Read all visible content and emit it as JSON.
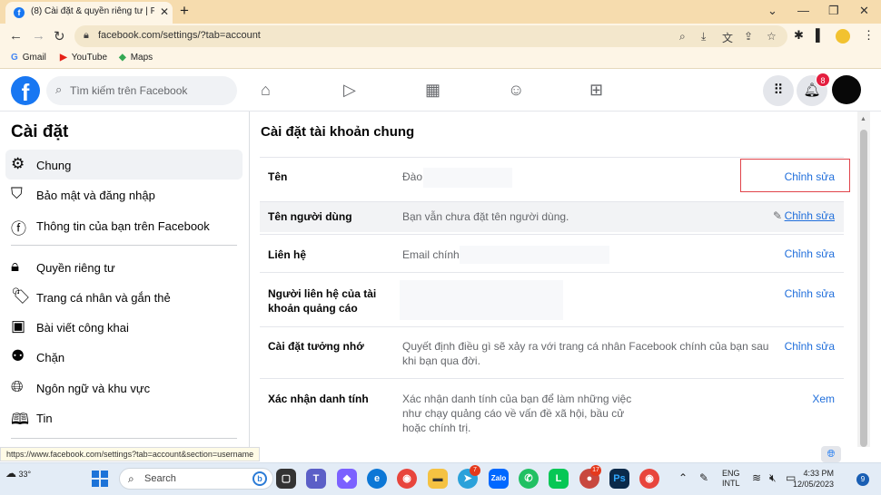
{
  "browser": {
    "tab_title": "(8) Cài đặt & quyền riêng tư | Fac",
    "tab_close": "✕",
    "new_tab": "+",
    "url": "facebook.com/settings/?tab=account",
    "bookmarks": [
      {
        "label": "Gmail",
        "icon": "G"
      },
      {
        "label": "YouTube",
        "icon": "▶"
      },
      {
        "label": "Maps",
        "icon": "◆"
      }
    ],
    "status_url": "https://www.facebook.com/settings?tab=account&section=username"
  },
  "fb": {
    "search_placeholder": "Tìm kiếm trên Facebook",
    "notification_count": "8",
    "logo": "f"
  },
  "sidebar": {
    "title": "Cài đặt",
    "items": [
      {
        "label": "Chung",
        "icon": "gear-icon"
      },
      {
        "label": "Bảo mật và đăng nhập",
        "icon": "shield-icon"
      },
      {
        "label": "Thông tin của bạn trên Facebook",
        "icon": "facebook-icon"
      },
      {
        "label": "Quyền riêng tư",
        "icon": "lock-icon"
      },
      {
        "label": "Trang cá nhân và gắn thẻ",
        "icon": "tag-icon"
      },
      {
        "label": "Bài viết công khai",
        "icon": "post-icon"
      },
      {
        "label": "Chặn",
        "icon": "block-user-icon"
      },
      {
        "label": "Ngôn ngữ và khu vực",
        "icon": "globe-icon"
      },
      {
        "label": "Tin",
        "icon": "book-icon"
      }
    ]
  },
  "main": {
    "title": "Cài đặt tài khoản chung",
    "rows": [
      {
        "key": "Tên",
        "value": "Đào",
        "action": "Chỉnh sửa"
      },
      {
        "key": "Tên người dùng",
        "value": "Bạn vẫn chưa đặt tên người dùng.",
        "action": "Chỉnh sửa"
      },
      {
        "key": "Liên hệ",
        "value": "Email chính:",
        "action": "Chỉnh sửa"
      },
      {
        "key": "Người liên hệ của tài khoản quảng cáo",
        "value": "",
        "action": "Chỉnh sửa"
      },
      {
        "key": "Cài đặt tưởng nhớ",
        "value": "Quyết định điều gì sẽ xảy ra với trang cá nhân Facebook chính của bạn sau khi bạn qua đời.",
        "action": "Chỉnh sửa"
      },
      {
        "key": "Xác nhận danh tính",
        "value": "Xác nhận danh tính của bạn để làm những việc như chạy quảng cáo về vấn đề xã hội, bầu cử hoặc chính trị.",
        "action": "Xem"
      }
    ]
  },
  "taskbar": {
    "weather": "33°",
    "search_label": "Search",
    "lang_line1": "ENG",
    "lang_line2": "INTL",
    "time": "4:33 PM",
    "date": "12/05/2023",
    "notifications": "9",
    "telegram_badge": "7",
    "app_badge": "17"
  }
}
